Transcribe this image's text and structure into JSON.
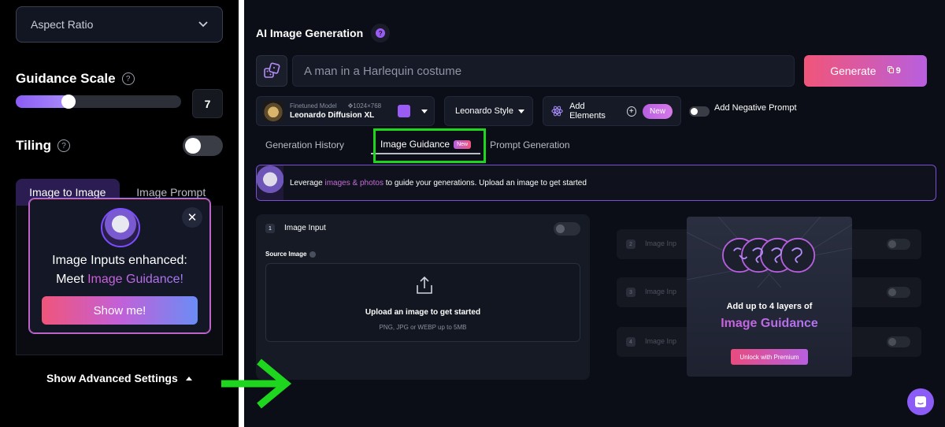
{
  "left_panel": {
    "aspect_ratio_label": "Aspect Ratio",
    "guidance_scale": {
      "title": "Guidance Scale",
      "help_icon": "question-icon",
      "value": "7",
      "fill_fraction": 0.32
    },
    "tiling": {
      "title": "Tiling",
      "help_icon": "question-icon",
      "enabled": false
    },
    "mode_tabs": [
      "Image to Image",
      "Image Prompt"
    ],
    "popup": {
      "line1": "Image Inputs enhanced:",
      "line2_prefix": "Meet ",
      "line2_highlight": "Image Guidance!",
      "button": "Show me!",
      "close_icon": "close-icon"
    },
    "advanced_settings": "Show Advanced Settings"
  },
  "right_panel": {
    "title": "AI Image Generation",
    "prompt_placeholder": "A man in a Harlequin costume",
    "generate": {
      "label": "Generate",
      "token_count": "9"
    },
    "model": {
      "tag": "Finetuned Model",
      "dimensions": "1024×768",
      "name": "Leonardo Diffusion XL"
    },
    "style": "Leonardo Style",
    "add_elements": {
      "label": "Add Elements",
      "badge": "New"
    },
    "negative_prompt_label": "Add Negative Prompt",
    "tabs": [
      {
        "label": "Generation History"
      },
      {
        "label": "Image Guidance",
        "badge": "New"
      },
      {
        "label": "Prompt Generation"
      }
    ],
    "banner": {
      "prefix": "Leverage ",
      "highlight": "images & photos",
      "suffix": " to guide your generations. Upload an image to get started"
    },
    "image_input": {
      "step": "1",
      "title": "Image Input",
      "source_label": "Source Image",
      "upload_main": "Upload an image to get started",
      "upload_sub": "PNG, JPG or WEBP up to 5MB"
    },
    "ghost_rows": [
      {
        "step": "2",
        "label": "Image Inp"
      },
      {
        "step": "3",
        "label": "Image Inp"
      },
      {
        "step": "4",
        "label": "Image Inp"
      }
    ],
    "promo": {
      "line1": "Add up to 4 layers of",
      "line2": "Image Guidance",
      "button": "Unlock with Premium"
    }
  },
  "colors": {
    "accent_purple": "#8b5cf6",
    "highlight_green": "#1ed61e",
    "generate_gradient": "#f0557a",
    "new_badge": "#b85fe0"
  }
}
